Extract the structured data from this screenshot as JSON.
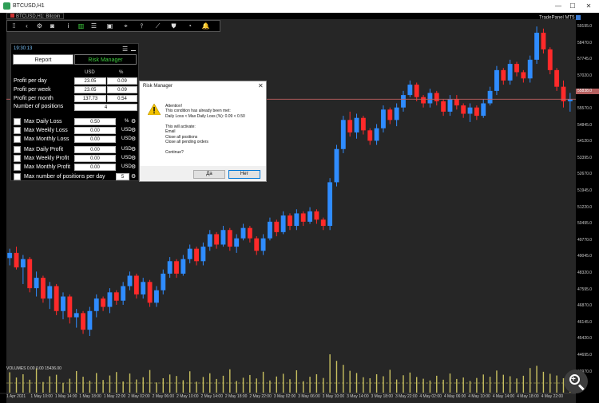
{
  "window": {
    "title": "BTCUSD,H1"
  },
  "chart_tab": {
    "label": "BTCUSD,H1: Bitcoin"
  },
  "toolbar": {
    "buttons": [
      {
        "name": "grip-icon",
        "glyph": "⁞⁞"
      },
      {
        "name": "chevron-left-icon",
        "glyph": "‹"
      },
      {
        "name": "gear-icon",
        "glyph": "⚙"
      },
      {
        "name": "camera-icon",
        "glyph": "◙"
      },
      {
        "name": "info-icon",
        "glyph": "i"
      },
      {
        "name": "bar-chart-icon",
        "glyph": "▥"
      },
      {
        "name": "list-icon",
        "glyph": "☰"
      },
      {
        "name": "save-icon",
        "glyph": "▣"
      },
      {
        "name": "crosshair-icon",
        "glyph": "⌖"
      },
      {
        "name": "period-separator-icon",
        "glyph": "⫯"
      },
      {
        "name": "trend-icon",
        "glyph": "⟋"
      },
      {
        "name": "shield-icon",
        "glyph": "⛊"
      },
      {
        "name": "pie-chart-icon",
        "glyph": "◔"
      },
      {
        "name": "bell-icon",
        "glyph": "🔔"
      }
    ]
  },
  "ticker": {
    "label": "TradePanel MT5"
  },
  "price_axis": {
    "labels": [
      "59195.0",
      "58470.0",
      "57745.0",
      "57020.0",
      "56295.0",
      "55570.0",
      "54845.0",
      "54120.0",
      "53395.0",
      "52670.0",
      "51945.0",
      "51220.0",
      "50495.0",
      "49770.0",
      "49045.0",
      "48320.0",
      "47595.0",
      "46870.0",
      "46145.0",
      "45420.0",
      "44695.0",
      "43970.0"
    ],
    "current_price": "55838.0"
  },
  "time_axis": {
    "labels": [
      "1 Apr 2021",
      "1 May 10:00",
      "1 May 14:00",
      "1 May 18:00",
      "1 May 22:00",
      "2 May 02:00",
      "2 May 06:00",
      "2 May 10:00",
      "2 May 14:00",
      "2 May 18:00",
      "2 May 22:00",
      "3 May 02:00",
      "3 May 06:00",
      "3 May 10:00",
      "3 May 14:00",
      "3 May 18:00",
      "3 May 22:00",
      "4 May 02:00",
      "4 May 06:00",
      "4 May 10:00",
      "4 May 14:00",
      "4 May 18:00",
      "4 May 22:00"
    ]
  },
  "indicator": {
    "label": "VOLUMES 0.00 0.00 15436.00"
  },
  "risk_panel": {
    "time": "19:30:13",
    "tabs": {
      "report": "Report",
      "risk_manager": "Risk Manager"
    },
    "columns": {
      "usd": "USD",
      "pct": "%"
    },
    "profit_rows": [
      {
        "label": "Profit per day",
        "usd": "23.05",
        "pct": "0.09"
      },
      {
        "label": "Profit per week",
        "usd": "23.05",
        "pct": "0.09"
      },
      {
        "label": "Profit per month",
        "usd": "137.73",
        "pct": "0.54"
      }
    ],
    "positions": {
      "label": "Number of positions",
      "value": "4"
    },
    "limits": [
      {
        "label": "Max Daily Loss",
        "value": "0.50",
        "unit": "%"
      },
      {
        "label": "Max Weekly Loss",
        "value": "0.00",
        "unit": "USD"
      },
      {
        "label": "Max Monthly Loss",
        "value": "0.00",
        "unit": "USD"
      },
      {
        "label": "Max Daily Profit",
        "value": "0.00",
        "unit": "USD"
      },
      {
        "label": "Max Weekly Profit",
        "value": "0.00",
        "unit": "USD"
      },
      {
        "label": "Max Monthly Profit",
        "value": "0.00",
        "unit": "USD"
      }
    ],
    "max_positions": {
      "label": "Max number of positions per day",
      "value": "5"
    }
  },
  "dialog": {
    "title": "Risk Manager",
    "lines": [
      "Attention!",
      "This condition has already been met:",
      "Daily Loss < Max Daily Loss (%): 0.09 < 0.50",
      "",
      "This will activate:",
      "Email",
      "Close all positions",
      "Close all pending orders",
      "",
      "Continue?"
    ],
    "yes_label": "Да",
    "no_label": "Нет"
  },
  "chart_data": {
    "type": "candlestick",
    "symbol": "BTCUSD",
    "timeframe": "H1",
    "ylim": [
      43900,
      59500
    ],
    "candles": [
      [
        48150,
        48600,
        47800,
        48400
      ],
      [
        48400,
        48700,
        47600,
        47700
      ],
      [
        47700,
        48300,
        46900,
        48100
      ],
      [
        48100,
        48200,
        46500,
        46700
      ],
      [
        46700,
        47500,
        46300,
        47200
      ],
      [
        47200,
        47300,
        46000,
        46200
      ],
      [
        46200,
        47000,
        45700,
        46800
      ],
      [
        46800,
        46900,
        45400,
        45600
      ],
      [
        45600,
        46500,
        45200,
        46300
      ],
      [
        46300,
        46400,
        45000,
        45300
      ],
      [
        45300,
        45700,
        44800,
        45500
      ],
      [
        45500,
        45600,
        44500,
        44700
      ],
      [
        44700,
        45800,
        44400,
        45600
      ],
      [
        45600,
        46400,
        45300,
        46200
      ],
      [
        46200,
        46300,
        45600,
        45800
      ],
      [
        45800,
        46700,
        45500,
        46500
      ],
      [
        46500,
        46600,
        45900,
        46100
      ],
      [
        46100,
        47000,
        45900,
        46800
      ],
      [
        46800,
        47500,
        46600,
        47300
      ],
      [
        47300,
        47400,
        46200,
        46400
      ],
      [
        46400,
        47200,
        46200,
        47000
      ],
      [
        47000,
        47100,
        45800,
        46000
      ],
      [
        46000,
        46800,
        45800,
        46600
      ],
      [
        46600,
        47600,
        46400,
        47400
      ],
      [
        47400,
        48200,
        47200,
        48000
      ],
      [
        48000,
        48100,
        47200,
        47400
      ],
      [
        47400,
        48300,
        47300,
        48100
      ],
      [
        48100,
        48800,
        47900,
        48600
      ],
      [
        48600,
        48700,
        47800,
        48000
      ],
      [
        48000,
        48900,
        47800,
        48700
      ],
      [
        48700,
        49500,
        48500,
        49300
      ],
      [
        49300,
        49400,
        48600,
        48800
      ],
      [
        48800,
        49700,
        48700,
        49500
      ],
      [
        49500,
        49600,
        48500,
        48700
      ],
      [
        48700,
        49300,
        48400,
        49100
      ],
      [
        49100,
        49800,
        49000,
        49600
      ],
      [
        49600,
        49700,
        48900,
        49100
      ],
      [
        49100,
        49200,
        48300,
        48500
      ],
      [
        48500,
        49300,
        48300,
        49100
      ],
      [
        49100,
        50100,
        49000,
        49900
      ],
      [
        49900,
        50000,
        49200,
        49400
      ],
      [
        49400,
        50400,
        49300,
        50200
      ],
      [
        50200,
        50300,
        49500,
        49700
      ],
      [
        49700,
        50500,
        49500,
        50300
      ],
      [
        50300,
        50400,
        49700,
        49900
      ],
      [
        49900,
        50600,
        49800,
        50400
      ],
      [
        50400,
        50500,
        49800,
        50000
      ],
      [
        50000,
        50100,
        49500,
        49700
      ],
      [
        49700,
        52000,
        49500,
        51800
      ],
      [
        51800,
        53600,
        51600,
        53400
      ],
      [
        53400,
        55000,
        53200,
        54800
      ],
      [
        54800,
        55200,
        54000,
        54200
      ],
      [
        54200,
        55100,
        53900,
        54900
      ],
      [
        54900,
        55000,
        54100,
        54300
      ],
      [
        54300,
        54400,
        53600,
        53800
      ],
      [
        53800,
        54600,
        53600,
        54400
      ],
      [
        54400,
        55500,
        54200,
        55300
      ],
      [
        55300,
        55400,
        54600,
        54800
      ],
      [
        54800,
        55600,
        54500,
        55400
      ],
      [
        55400,
        56200,
        55200,
        56000
      ],
      [
        56000,
        56700,
        55900,
        56500
      ],
      [
        56500,
        56600,
        55700,
        55900
      ],
      [
        55900,
        56000,
        55400,
        55600
      ],
      [
        55600,
        56300,
        55400,
        56100
      ],
      [
        56100,
        56200,
        55500,
        55700
      ],
      [
        55700,
        55800,
        55000,
        55200
      ],
      [
        55200,
        56000,
        55000,
        55800
      ],
      [
        55800,
        56000,
        55300,
        55500
      ],
      [
        55500,
        55600,
        54900,
        55100
      ],
      [
        55100,
        55600,
        54700,
        55400
      ],
      [
        55400,
        55500,
        54800,
        55000
      ],
      [
        55000,
        55800,
        54900,
        55600
      ],
      [
        55600,
        56400,
        55500,
        56200
      ],
      [
        56200,
        57400,
        56000,
        57200
      ],
      [
        57200,
        57300,
        56500,
        56700
      ],
      [
        56700,
        57700,
        56500,
        57500
      ],
      [
        57500,
        57600,
        56900,
        57100
      ],
      [
        57100,
        57200,
        56600,
        56800
      ],
      [
        56800,
        57900,
        56600,
        57700
      ],
      [
        57700,
        59300,
        57500,
        59000
      ],
      [
        59000,
        59200,
        58000,
        58200
      ],
      [
        58200,
        58300,
        57000,
        57200
      ],
      [
        57200,
        57300,
        56200,
        56400
      ],
      [
        56400,
        56700,
        55400,
        55700
      ],
      [
        55700,
        56100,
        55200,
        55800
      ]
    ],
    "volumes": [
      8200,
      6100,
      7400,
      5200,
      9800,
      4300,
      6600,
      7200,
      3900,
      5600,
      8700,
      6400,
      4800,
      7900,
      5100,
      6900,
      8300,
      4500,
      7700,
      5300,
      6200,
      9100,
      4100,
      5800,
      7300,
      6700,
      5000,
      8600,
      4400,
      6300,
      7800,
      5500,
      6800,
      9400,
      4700,
      6000,
      7100,
      5700,
      8400,
      4900,
      6500,
      7600,
      5400,
      9000,
      4600,
      6400,
      7400,
      5900,
      15436,
      12800,
      11200,
      8800,
      7900,
      6200,
      5800,
      7400,
      6600,
      9200,
      5300,
      7000,
      8100,
      6300,
      5600,
      4900,
      6800,
      5200,
      7700,
      5500,
      6100,
      4700,
      5900,
      7300,
      6400,
      8900,
      7200,
      6600,
      5700,
      6800,
      9900,
      10800,
      8400,
      7600,
      6900,
      5800,
      7000
    ]
  }
}
